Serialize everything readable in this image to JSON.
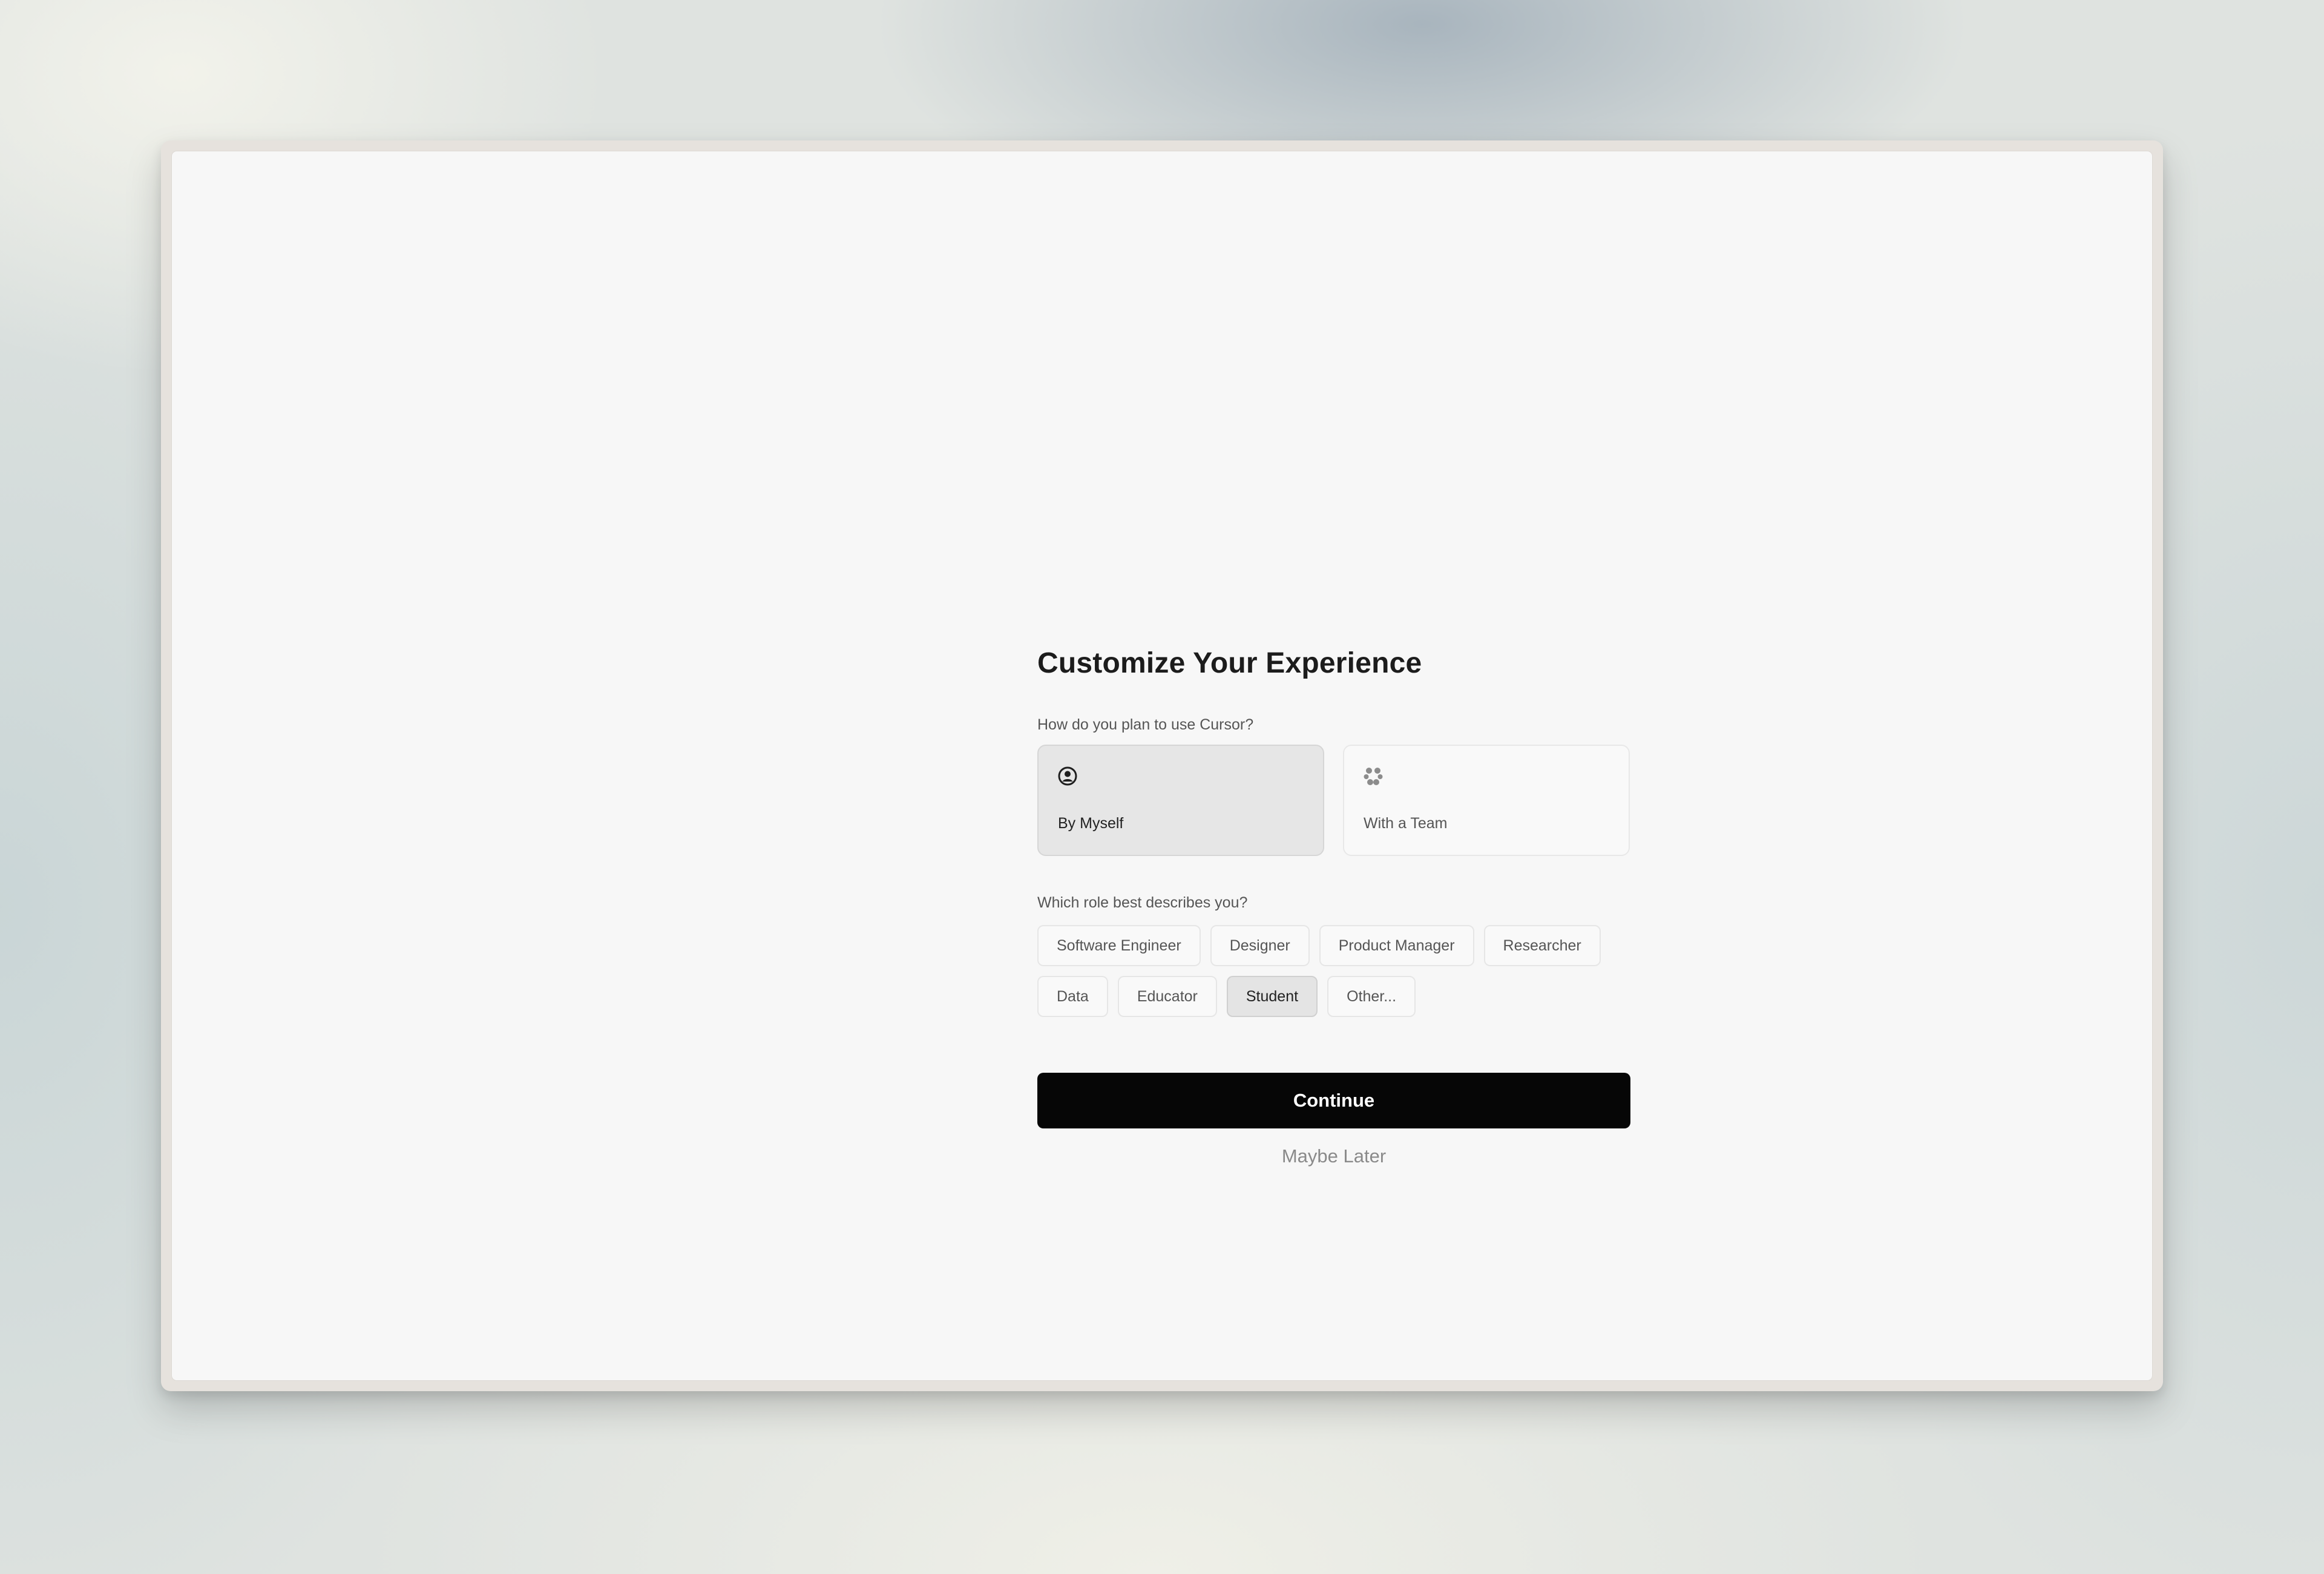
{
  "onboarding": {
    "title": "Customize Your Experience",
    "usage_question": "How do you plan to use Cursor?",
    "usage_options": [
      {
        "label": "By Myself",
        "icon": "user-circle-icon",
        "selected": true
      },
      {
        "label": "With a Team",
        "icon": "team-icon",
        "selected": false
      }
    ],
    "role_question": "Which role best describes you?",
    "roles": [
      {
        "label": "Software Engineer",
        "selected": false
      },
      {
        "label": "Designer",
        "selected": false
      },
      {
        "label": "Product Manager",
        "selected": false
      },
      {
        "label": "Researcher",
        "selected": false
      },
      {
        "label": "Data",
        "selected": false
      },
      {
        "label": "Educator",
        "selected": false
      },
      {
        "label": "Student",
        "selected": true
      },
      {
        "label": "Other...",
        "selected": false
      }
    ],
    "continue_label": "Continue",
    "maybe_later_label": "Maybe Later"
  },
  "colors": {
    "primary_button": "#060606",
    "selected_fill": "#e6e6e6",
    "window_background": "#f7f7f7"
  }
}
